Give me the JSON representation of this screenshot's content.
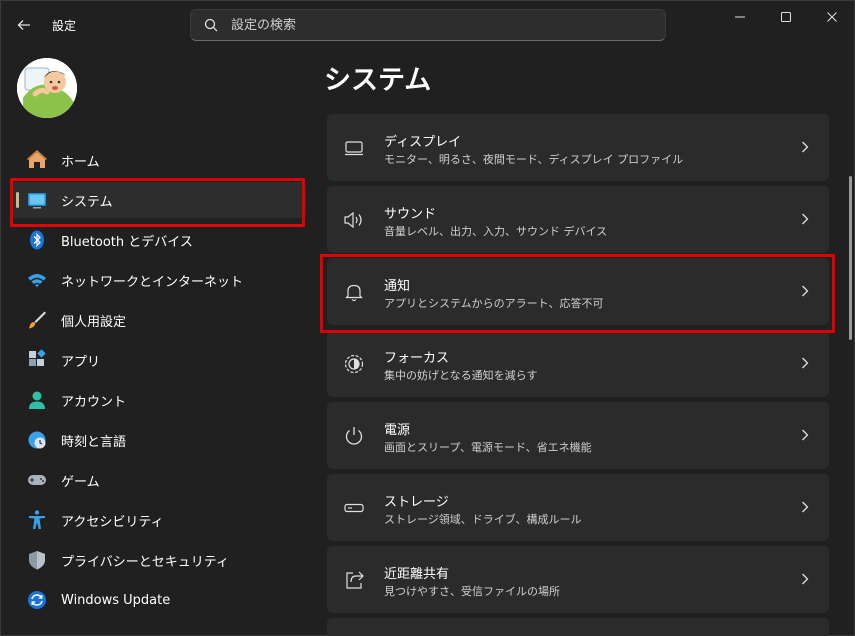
{
  "window": {
    "title": "設定",
    "search_placeholder": "設定の検索"
  },
  "sidebar": {
    "items": [
      {
        "label": "ホーム",
        "icon": "home-icon"
      },
      {
        "label": "システム",
        "icon": "system-monitor-icon",
        "selected": true
      },
      {
        "label": "Bluetooth とデバイス",
        "icon": "bluetooth-icon"
      },
      {
        "label": "ネットワークとインターネット",
        "icon": "wifi-icon"
      },
      {
        "label": "個人用設定",
        "icon": "paintbrush-icon"
      },
      {
        "label": "アプリ",
        "icon": "apps-icon"
      },
      {
        "label": "アカウント",
        "icon": "account-icon"
      },
      {
        "label": "時刻と言語",
        "icon": "time-language-icon"
      },
      {
        "label": "ゲーム",
        "icon": "gamepad-icon"
      },
      {
        "label": "アクセシビリティ",
        "icon": "accessibility-icon"
      },
      {
        "label": "プライバシーとセキュリティ",
        "icon": "shield-icon"
      },
      {
        "label": "Windows Update",
        "icon": "windows-update-icon"
      }
    ]
  },
  "main": {
    "title": "システム",
    "cards": [
      {
        "title": "ディスプレイ",
        "subtitle": "モニター、明るさ、夜間モード、ディスプレイ プロファイル",
        "icon": "display-icon"
      },
      {
        "title": "サウンド",
        "subtitle": "音量レベル、出力、入力、サウンド デバイス",
        "icon": "speaker-icon"
      },
      {
        "title": "通知",
        "subtitle": "アプリとシステムからのアラート、応答不可",
        "icon": "bell-icon"
      },
      {
        "title": "フォーカス",
        "subtitle": "集中の妨げとなる通知を減らす",
        "icon": "focus-icon"
      },
      {
        "title": "電源",
        "subtitle": "画面とスリープ、電源モード、省エネ機能",
        "icon": "power-icon"
      },
      {
        "title": "ストレージ",
        "subtitle": "ストレージ領域、ドライブ、構成ルール",
        "icon": "storage-icon"
      },
      {
        "title": "近距離共有",
        "subtitle": "見つけやすさ、受信ファイルの場所",
        "icon": "share-icon"
      }
    ]
  },
  "colors": {
    "background": "#202020",
    "card": "#2b2b2b",
    "selected_item": "#2d2d2d",
    "highlight_box": "#e00000",
    "selection_indicator": "#c9b98a"
  }
}
